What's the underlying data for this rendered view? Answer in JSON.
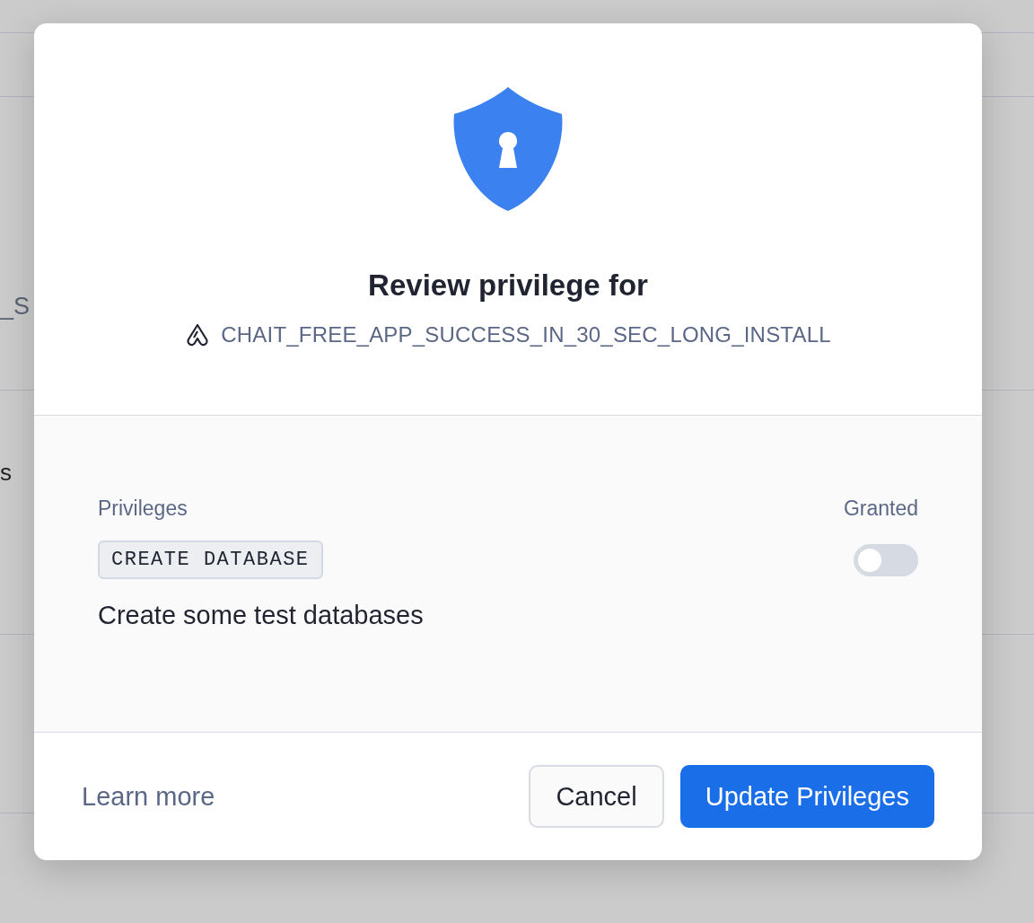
{
  "background": {
    "texts": [
      "_S",
      "s"
    ]
  },
  "dialog": {
    "title": "Review privilege for",
    "app_name": "CHAIT_FREE_APP_SUCCESS_IN_30_SEC_LONG_INSTALL",
    "columns": [
      "Privileges",
      "Granted"
    ],
    "privileges": [
      {
        "name": "CREATE DATABASE",
        "description": "Create some test databases",
        "granted": false
      }
    ],
    "link": "Learn more",
    "buttons": [
      {
        "label": "Cancel",
        "kind": "secondary"
      },
      {
        "label": "Update Privileges",
        "kind": "primary"
      }
    ]
  }
}
